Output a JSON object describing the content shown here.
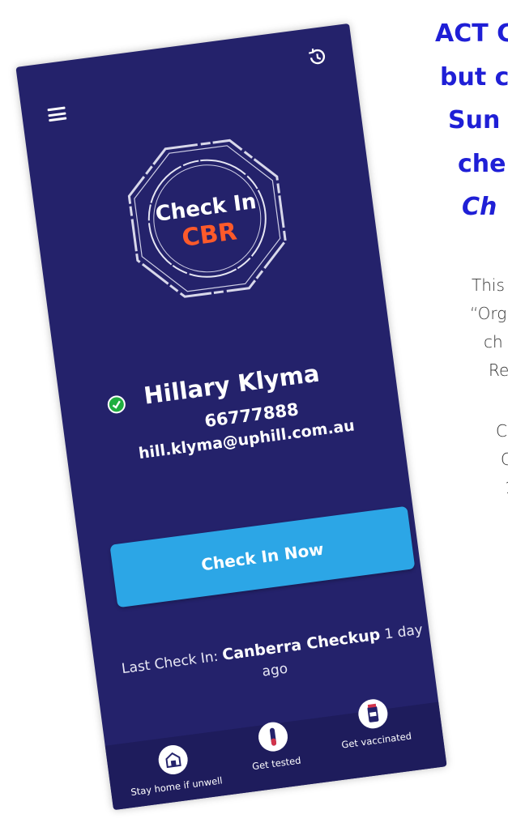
{
  "article": {
    "headline_lines": [
      "ACT C",
      "but c",
      "Sun",
      "che",
      "Ch"
    ],
    "body_lines": [
      "This",
      "“Org",
      "ch",
      "Re",
      "C",
      "C",
      "1"
    ]
  },
  "app": {
    "logo": {
      "line1": "Check In",
      "line2": "CBR"
    },
    "user": {
      "name": "Hillary Klyma",
      "phone": "66777888",
      "email": "hill.klyma@uphill.com.au"
    },
    "checkin_button_label": "Check In Now",
    "last_checkin": {
      "prefix": "Last Check In: ",
      "venue": "Canberra Checkup",
      "suffix": " 1 day ago"
    },
    "nav": [
      {
        "label": "Stay home if unwell",
        "icon": "house-icon"
      },
      {
        "label": "Get tested",
        "icon": "test-tube-icon"
      },
      {
        "label": "Get vaccinated",
        "icon": "vaccine-vial-icon"
      }
    ],
    "colors": {
      "background": "#24226b",
      "button": "#2ca6e6",
      "logo_accent": "#ff5a2a",
      "verified": "#1fae3f",
      "headline": "#1f1fd6"
    }
  }
}
